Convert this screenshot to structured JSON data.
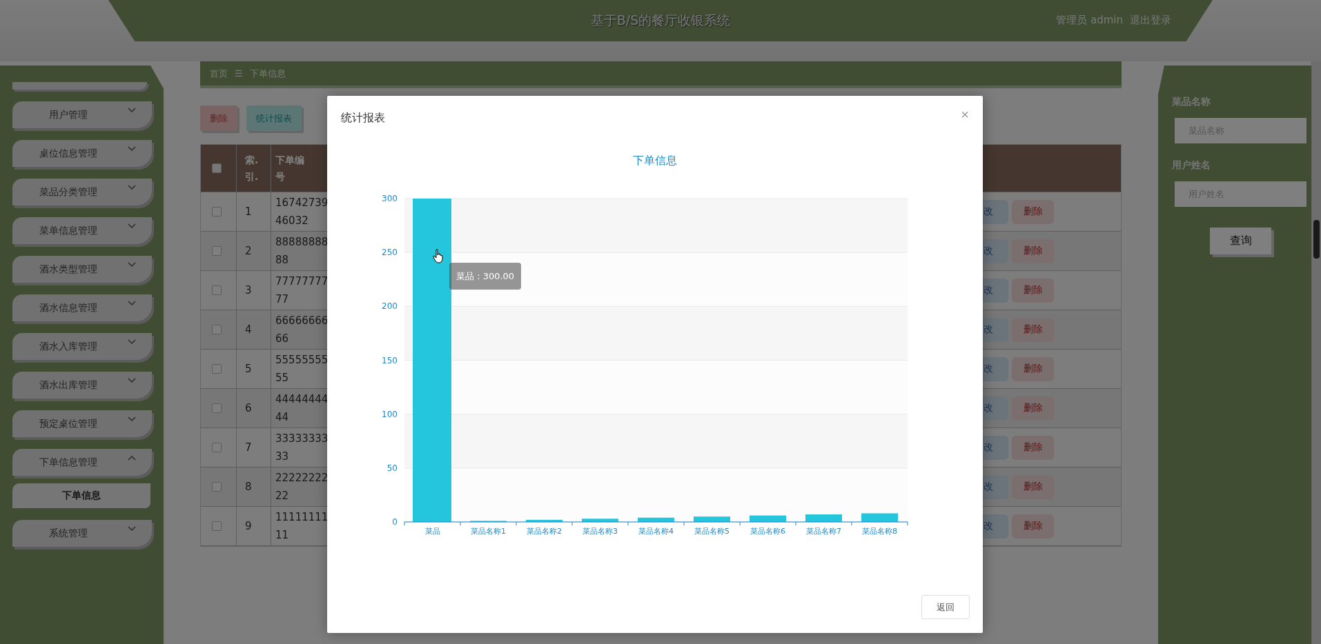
{
  "header": {
    "title": "基于B/S的餐厅收银系统",
    "user": "管理员 admin",
    "logout": "退出登录"
  },
  "sidebar": {
    "items": [
      {
        "label": "用户管理",
        "expanded": false
      },
      {
        "label": "桌位信息管理",
        "expanded": false
      },
      {
        "label": "菜品分类管理",
        "expanded": false
      },
      {
        "label": "菜单信息管理",
        "expanded": false
      },
      {
        "label": "酒水类型管理",
        "expanded": false
      },
      {
        "label": "酒水信息管理",
        "expanded": false
      },
      {
        "label": "酒水入库管理",
        "expanded": false
      },
      {
        "label": "酒水出库管理",
        "expanded": false
      },
      {
        "label": "预定桌位管理",
        "expanded": false
      },
      {
        "label": "下单信息管理",
        "expanded": true,
        "children": [
          {
            "label": "下单信息"
          }
        ]
      },
      {
        "label": "系统管理",
        "expanded": false
      }
    ]
  },
  "breadcrumb": {
    "home": "首页",
    "separator": "☰",
    "current": "下单信息"
  },
  "toolbar": {
    "delete": "删除",
    "report": "统计报表"
  },
  "table": {
    "header_checked": false,
    "columns": [
      "索.引.",
      "下单编号"
    ],
    "rows": [
      {
        "checked": false,
        "index": "1",
        "number": "1674273946032",
        "edit": "改",
        "delete": "删除"
      },
      {
        "checked": false,
        "index": "2",
        "number": "8888888888",
        "edit": "改",
        "delete": "删除"
      },
      {
        "checked": false,
        "index": "3",
        "number": "7777777777",
        "edit": "改",
        "delete": "删除"
      },
      {
        "checked": false,
        "index": "4",
        "number": "6666666666",
        "edit": "改",
        "delete": "删除"
      },
      {
        "checked": false,
        "index": "5",
        "number": "5555555555",
        "edit": "改",
        "delete": "删除"
      },
      {
        "checked": false,
        "index": "6",
        "number": "4444444444",
        "edit": "改",
        "delete": "删除"
      },
      {
        "checked": false,
        "index": "7",
        "number": "3333333333",
        "edit": "改",
        "delete": "删除"
      },
      {
        "checked": false,
        "index": "8",
        "number": "2222222222",
        "edit": "改",
        "delete": "删除"
      },
      {
        "checked": false,
        "index": "9",
        "number": "1111111111",
        "edit": "改",
        "delete": "删除"
      }
    ]
  },
  "search": {
    "fields": [
      {
        "label": "菜品名称",
        "placeholder": "菜品名称"
      },
      {
        "label": "用户姓名",
        "placeholder": "用户姓名"
      }
    ],
    "button": "查询"
  },
  "modal": {
    "title": "统计报表",
    "close": "×",
    "tooltip": "菜品 : 300.00",
    "back": "返回",
    "chart_data": {
      "type": "bar",
      "title": "下单信息",
      "categories": [
        "菜品",
        "菜品名称1",
        "菜品名称2",
        "菜品名称3",
        "菜品名称4",
        "菜品名称5",
        "菜品名称6",
        "菜品名称7",
        "菜品名称8"
      ],
      "values": [
        300,
        1,
        2,
        3,
        4,
        5,
        6,
        7,
        8
      ],
      "ylim": [
        0,
        300
      ],
      "yticks": [
        0,
        50,
        100,
        150,
        200,
        250,
        300
      ],
      "grid": true
    }
  }
}
